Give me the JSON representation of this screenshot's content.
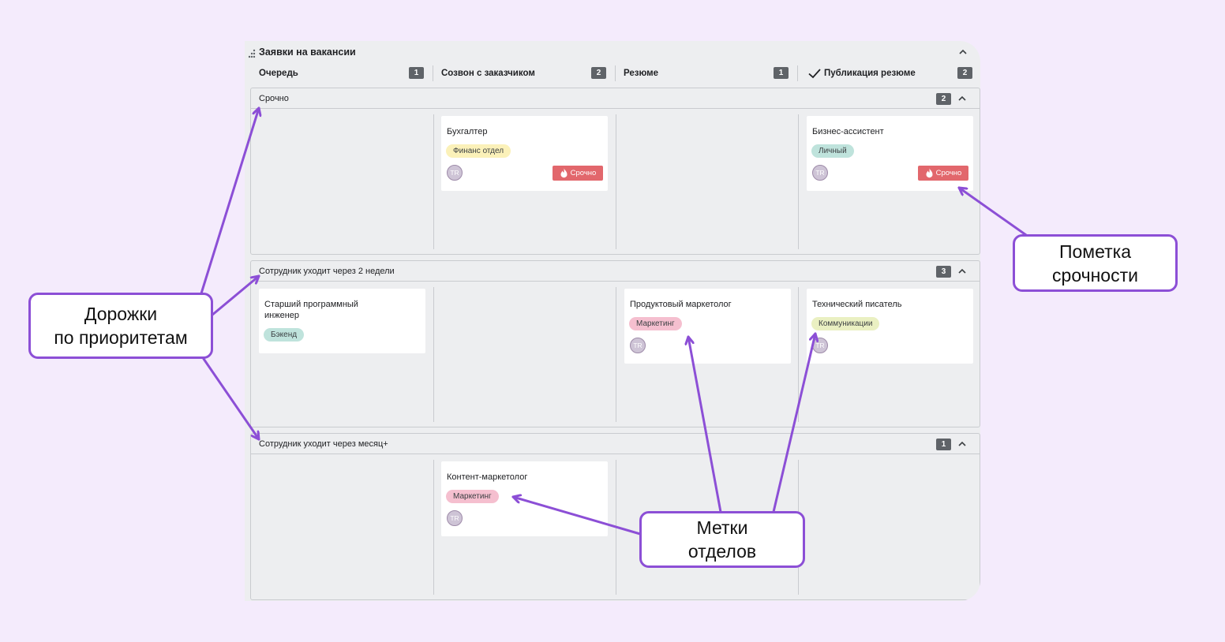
{
  "board": {
    "title": "Заявки на вакансии",
    "columns": [
      {
        "label": "Очередь",
        "count": "1"
      },
      {
        "label": "Созвон с заказчиком",
        "count": "2"
      },
      {
        "label": "Резюме",
        "count": "1"
      },
      {
        "label": "Публикация резюме",
        "count": "2",
        "icon": "check-icon"
      }
    ]
  },
  "lanes": [
    {
      "title": "Срочно",
      "count": "2",
      "cards": [
        {
          "title": "Бухгалтер",
          "tag": "Финанс отдел",
          "tag_color": "#fbf1b9",
          "avatar": "TR",
          "urgent": "Срочно"
        },
        {
          "title": "Бизнес-ассистент",
          "tag": "Личный",
          "tag_color": "#bfe3dc",
          "avatar": "TR",
          "urgent": "Срочно"
        }
      ]
    },
    {
      "title": "Сотрудник уходит через 2 недели",
      "count": "3",
      "cards": [
        {
          "title": "Старший программный инженер",
          "tag": "Бэкенд",
          "tag_color": "#bfe3dc"
        },
        {
          "title": "Продуктовый маркетолог",
          "tag": "Маркетинг",
          "tag_color": "#f5bfcf",
          "avatar": "TR"
        },
        {
          "title": "Технический писатель",
          "tag": "Коммуникации",
          "tag_color": "#eaf0c2",
          "avatar": "TR"
        }
      ]
    },
    {
      "title": "Сотрудник уходит через месяц+",
      "count": "1",
      "cards": [
        {
          "title": "Контент-маркетолог",
          "tag": "Маркетинг",
          "tag_color": "#f5bfcf",
          "avatar": "TR"
        }
      ]
    }
  ],
  "callouts": {
    "lanes": [
      "Дорожки",
      "по приоритетам"
    ],
    "urgency": [
      "Пометка",
      "срочности"
    ],
    "departments": [
      "Метки",
      "отделов"
    ]
  },
  "colors": {
    "background": "#f4ebfc",
    "accent": "#8c4fd6",
    "urgent": "#e2676c",
    "count_badge": "#5f6368"
  }
}
